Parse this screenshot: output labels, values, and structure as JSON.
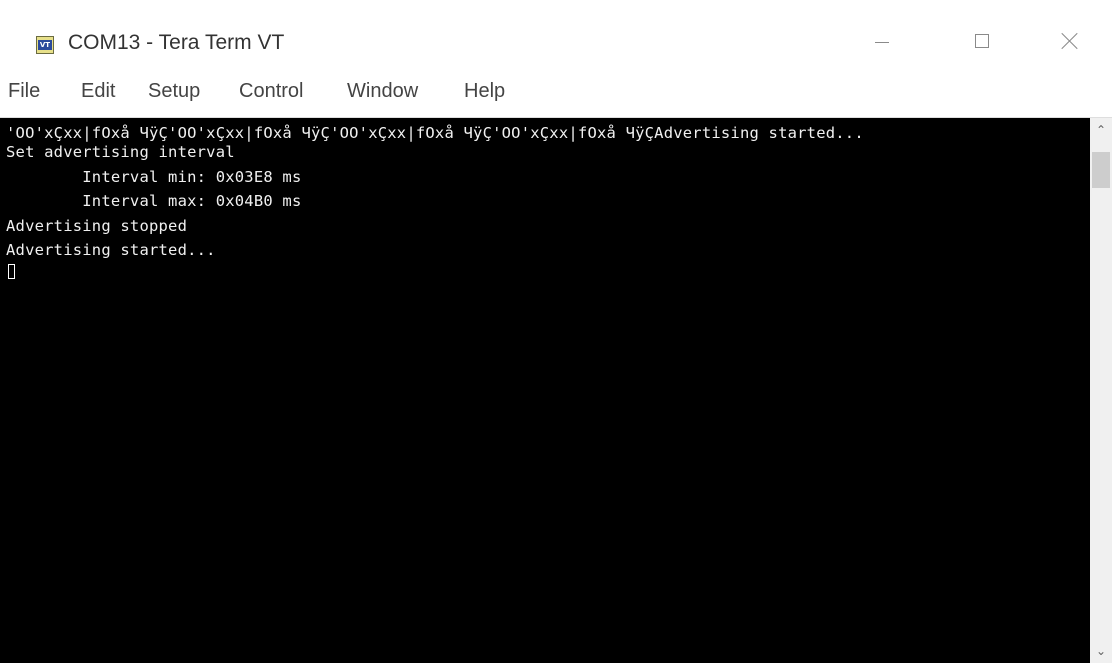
{
  "window": {
    "title": "COM13 - Tera Term VT",
    "icon_label": "VT",
    "controls": {
      "minimize": "minimize-icon",
      "maximize": "maximize-icon",
      "close": "close-icon"
    }
  },
  "menu": {
    "items": [
      "File",
      "Edit",
      "Setup",
      "Control",
      "Window",
      "Help"
    ]
  },
  "terminal": {
    "lines": [
      "'OO'xÇxx|fOxå ЧÿÇ'OO'xÇxx|fOxå ЧÿÇ'OO'xÇxx|fOxå ЧÿÇ'OO'xÇxx|fOxå ЧÿÇAdvertising started...",
      "Set advertising interval",
      "        Interval min: 0x03E8 ms",
      "        Interval max: 0x04B0 ms",
      "Advertising stopped",
      "Advertising started..."
    ],
    "background": "#000000",
    "foreground": "#f0f0f0"
  },
  "scrollbar": {
    "up_icon": "chevron-up-icon",
    "down_icon": "chevron-down-icon"
  }
}
